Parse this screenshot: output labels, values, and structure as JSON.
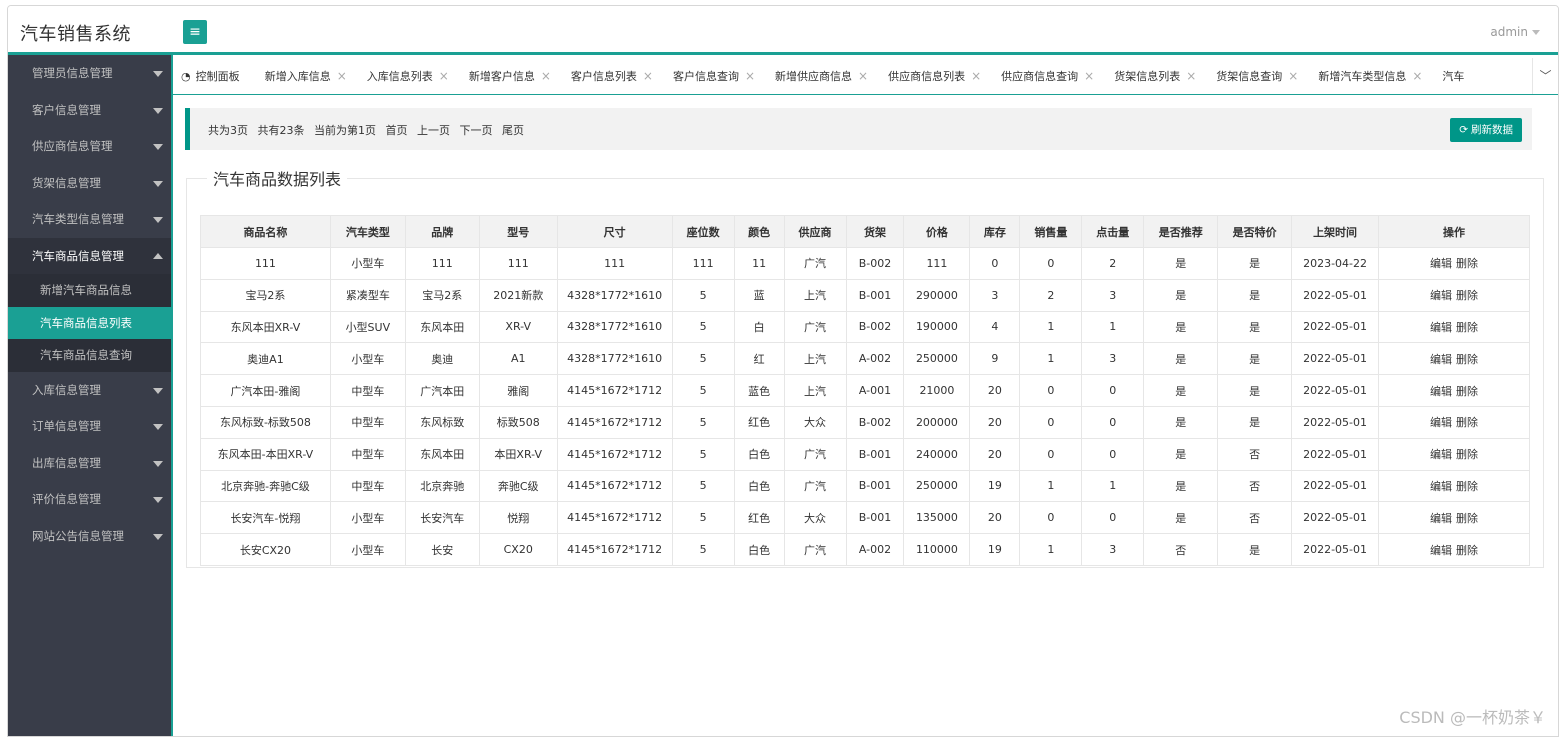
{
  "app": {
    "title": "汽车销售系统",
    "user": "admin"
  },
  "sidebar": {
    "items": [
      {
        "label": "管理员信息管理"
      },
      {
        "label": "客户信息管理"
      },
      {
        "label": "供应商信息管理"
      },
      {
        "label": "货架信息管理"
      },
      {
        "label": "汽车类型信息管理"
      },
      {
        "label": "汽车商品信息管理",
        "open": true,
        "children": [
          "新增汽车商品信息",
          "汽车商品信息列表",
          "汽车商品信息查询"
        ],
        "active_child": 1
      },
      {
        "label": "入库信息管理"
      },
      {
        "label": "订单信息管理"
      },
      {
        "label": "出库信息管理"
      },
      {
        "label": "评价信息管理"
      },
      {
        "label": "网站公告信息管理"
      }
    ]
  },
  "tabs": {
    "home": "控制面板",
    "items": [
      "新增入库信息",
      "入库信息列表",
      "新增客户信息",
      "客户信息列表",
      "客户信息查询",
      "新增供应商信息",
      "供应商信息列表",
      "供应商信息查询",
      "货架信息列表",
      "货架信息查询",
      "新增汽车类型信息",
      "汽车"
    ]
  },
  "pager": {
    "total_pages": "共为3页",
    "total_records": "共有23条",
    "current": "当前为第1页",
    "first": "首页",
    "prev": "上一页",
    "next": "下一页",
    "last": "尾页",
    "refresh_label": "刷新数据"
  },
  "panel": {
    "title": "汽车商品数据列表",
    "columns": [
      "商品名称",
      "汽车类型",
      "品牌",
      "型号",
      "尺寸",
      "座位数",
      "颜色",
      "供应商",
      "货架",
      "价格",
      "库存",
      "销售量",
      "点击量",
      "是否推荐",
      "是否特价",
      "上架时间",
      "操作"
    ],
    "edit_label": "编辑",
    "delete_label": "删除",
    "rows": [
      [
        "111",
        "小型车",
        "111",
        "111",
        "111",
        "111",
        "11",
        "广汽",
        "B-002",
        "111",
        "0",
        "0",
        "2",
        "是",
        "是",
        "2023-04-22"
      ],
      [
        "宝马2系",
        "紧凑型车",
        "宝马2系",
        "2021新款",
        "4328*1772*1610",
        "5",
        "蓝",
        "上汽",
        "B-001",
        "290000",
        "3",
        "2",
        "3",
        "是",
        "是",
        "2022-05-01"
      ],
      [
        "东风本田XR-V",
        "小型SUV",
        "东风本田",
        "XR-V",
        "4328*1772*1610",
        "5",
        "白",
        "广汽",
        "B-002",
        "190000",
        "4",
        "1",
        "1",
        "是",
        "是",
        "2022-05-01"
      ],
      [
        "奥迪A1",
        "小型车",
        "奥迪",
        "A1",
        "4328*1772*1610",
        "5",
        "红",
        "上汽",
        "A-002",
        "250000",
        "9",
        "1",
        "3",
        "是",
        "是",
        "2022-05-01"
      ],
      [
        "广汽本田-雅阁",
        "中型车",
        "广汽本田",
        "雅阁",
        "4145*1672*1712",
        "5",
        "蓝色",
        "上汽",
        "A-001",
        "21000",
        "20",
        "0",
        "0",
        "是",
        "是",
        "2022-05-01"
      ],
      [
        "东风标致-标致508",
        "中型车",
        "东风标致",
        "标致508",
        "4145*1672*1712",
        "5",
        "红色",
        "大众",
        "B-002",
        "200000",
        "20",
        "0",
        "0",
        "是",
        "是",
        "2022-05-01"
      ],
      [
        "东风本田-本田XR-V",
        "中型车",
        "东风本田",
        "本田XR-V",
        "4145*1672*1712",
        "5",
        "白色",
        "广汽",
        "B-001",
        "240000",
        "20",
        "0",
        "0",
        "是",
        "否",
        "2022-05-01"
      ],
      [
        "北京奔驰-奔驰C级",
        "中型车",
        "北京奔驰",
        "奔驰C级",
        "4145*1672*1712",
        "5",
        "白色",
        "广汽",
        "B-001",
        "250000",
        "19",
        "1",
        "1",
        "是",
        "否",
        "2022-05-01"
      ],
      [
        "长安汽车-悦翔",
        "小型车",
        "长安汽车",
        "悦翔",
        "4145*1672*1712",
        "5",
        "红色",
        "大众",
        "B-001",
        "135000",
        "20",
        "0",
        "0",
        "是",
        "否",
        "2022-05-01"
      ],
      [
        "长安CX20",
        "小型车",
        "长安",
        "CX20",
        "4145*1672*1712",
        "5",
        "白色",
        "广汽",
        "A-002",
        "110000",
        "19",
        "1",
        "3",
        "否",
        "是",
        "2022-05-01"
      ]
    ]
  },
  "watermark": "CSDN @一杯奶茶￥",
  "colors": {
    "accent": "#009688",
    "sidebar": "#393d49"
  }
}
